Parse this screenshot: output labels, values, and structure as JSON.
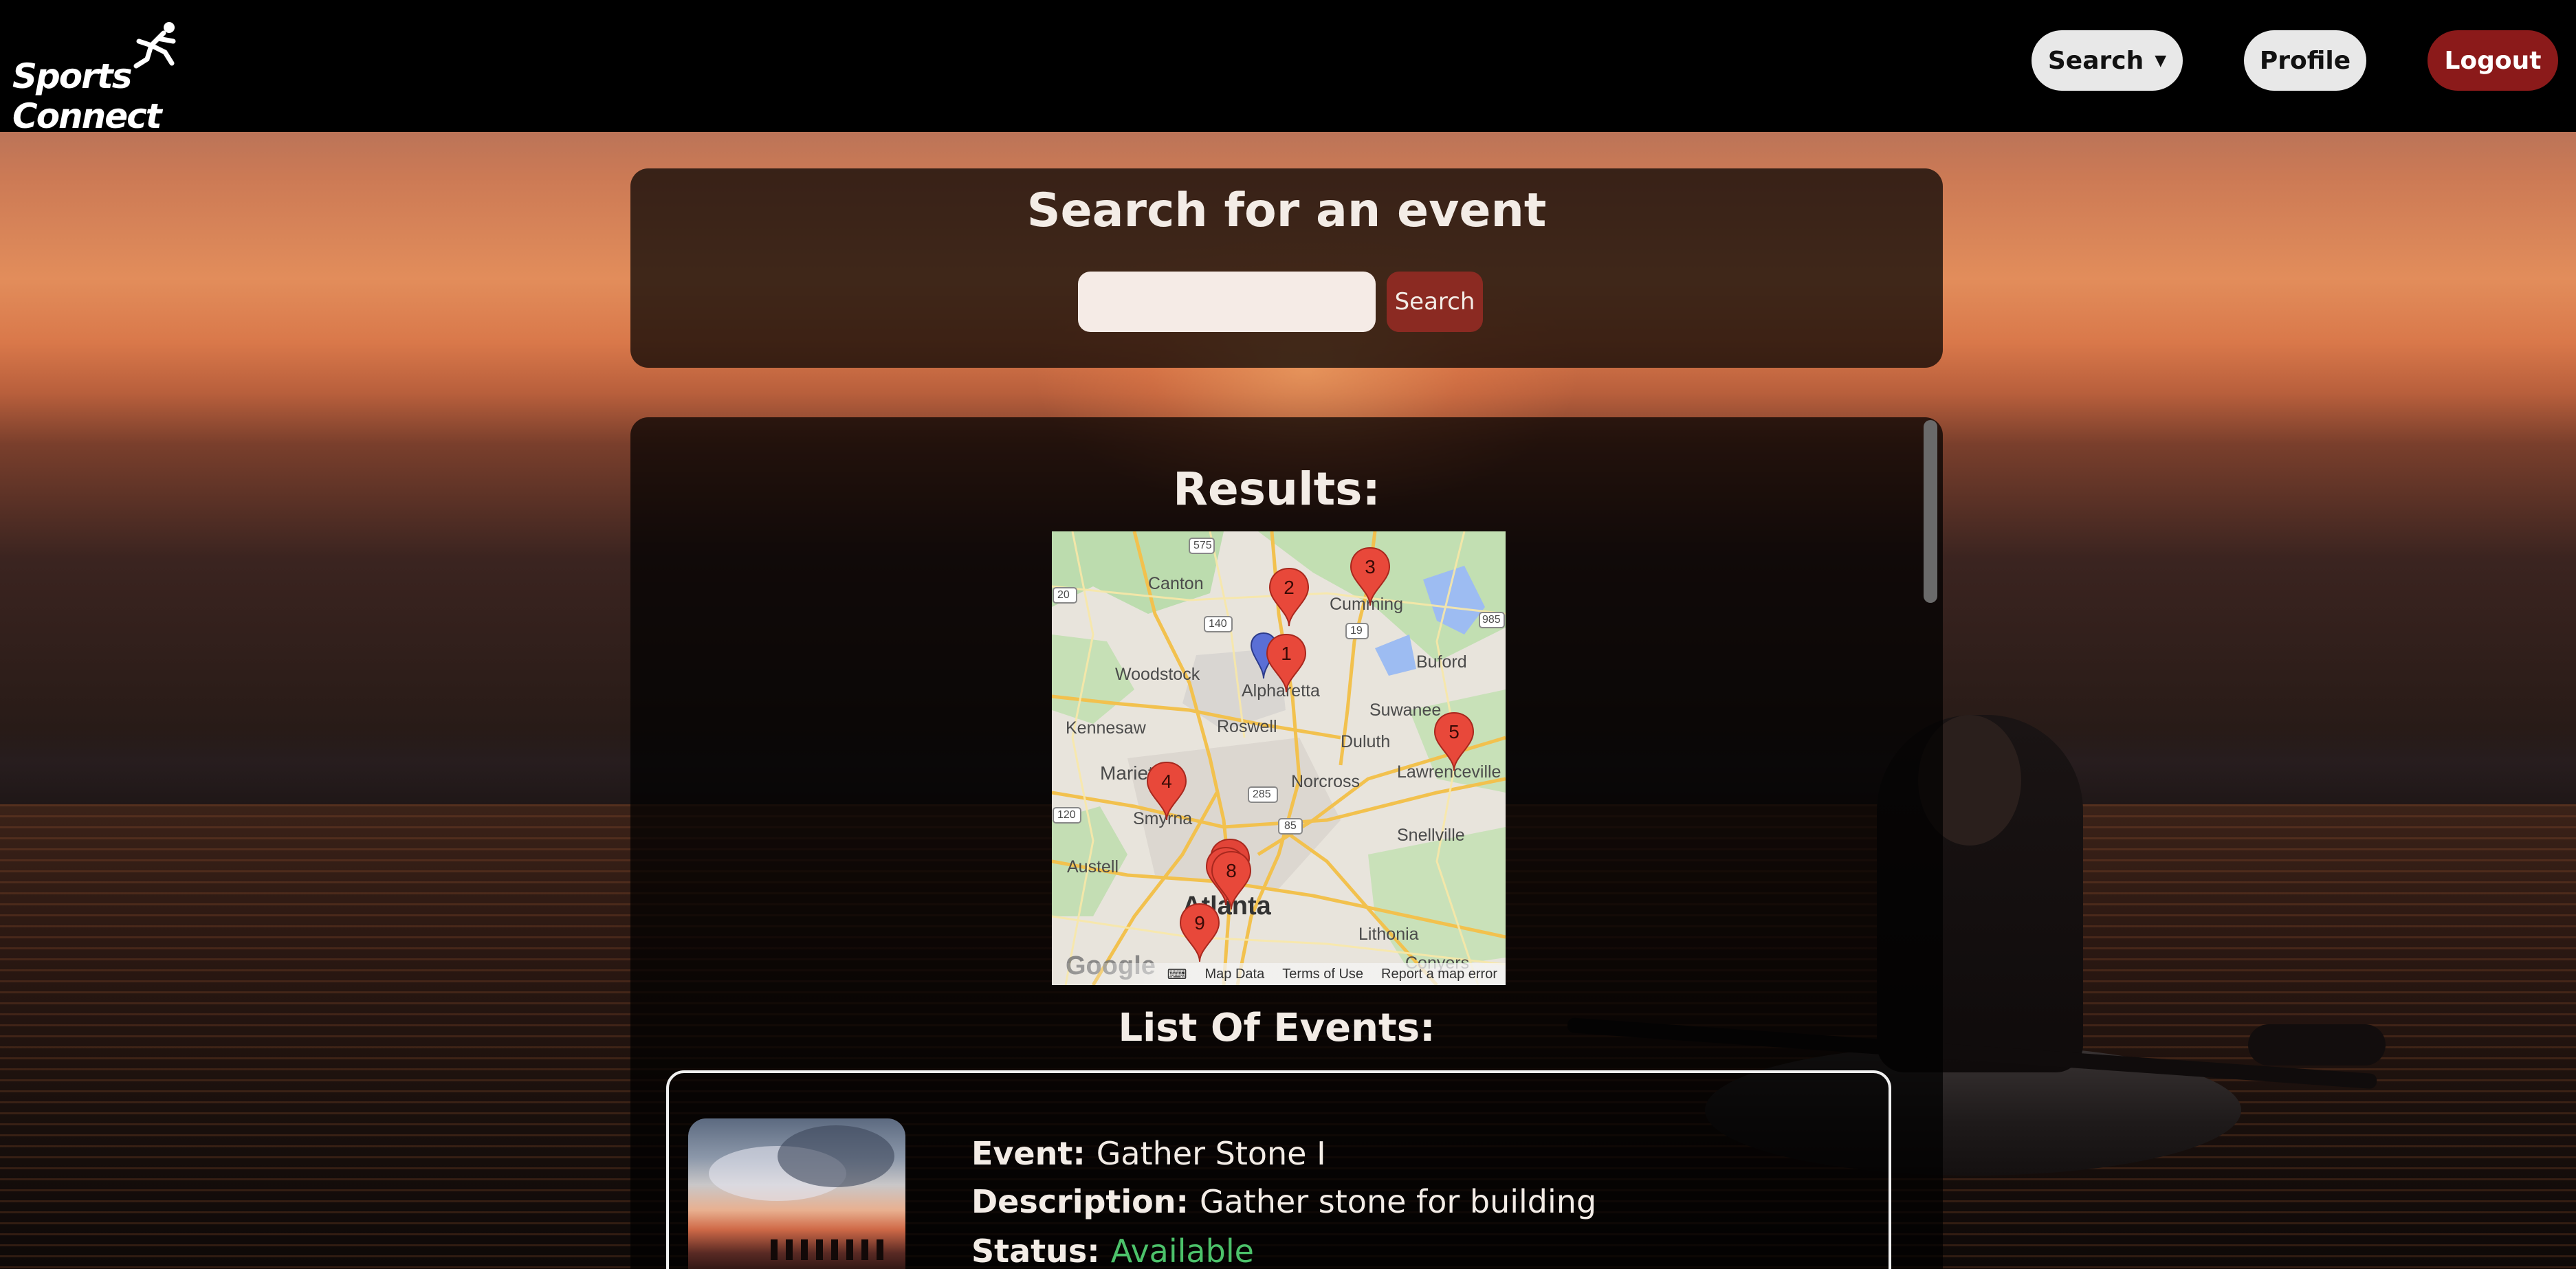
{
  "app": {
    "brand": "Sports Connect"
  },
  "nav": {
    "search_label": "Search",
    "search_caret": "▼",
    "profile_label": "Profile",
    "logout_label": "Logout"
  },
  "search": {
    "title": "Search for an event",
    "input_value": "",
    "button_label": "Search"
  },
  "results": {
    "title": "Results:",
    "list_title": "List Of Events:"
  },
  "map": {
    "place_labels": [
      "Canton",
      "Cumming",
      "Woodstock",
      "Alpharetta",
      "Buford",
      "Roswell",
      "Suwanee",
      "Kennesaw",
      "Duluth",
      "Lawrenceville",
      "Marietta",
      "Norcross",
      "Smyrna",
      "Snellville",
      "Austell",
      "Atlanta",
      "Lithonia",
      "Conyers"
    ],
    "highway_labels": [
      "575",
      "20",
      "140",
      "19",
      "985",
      "285",
      "85",
      "120"
    ],
    "markers": [
      "1",
      "2",
      "3",
      "4",
      "5",
      "8",
      "9"
    ],
    "footer": {
      "logo": "Google",
      "map_data": "Map Data",
      "terms": "Terms of Use",
      "report": "Report a map error"
    }
  },
  "events": [
    {
      "event_label": "Event:",
      "event_value": "Gather Stone I",
      "description_label": "Description:",
      "description_value": "Gather stone for building",
      "status_label": "Status:",
      "status_value": "Available"
    }
  ],
  "colors": {
    "navbar": "#000000",
    "logout": "#8b1a1a",
    "search_button": "#8b2a22",
    "status_available": "#4cc26a",
    "marker": "#e8483a"
  }
}
